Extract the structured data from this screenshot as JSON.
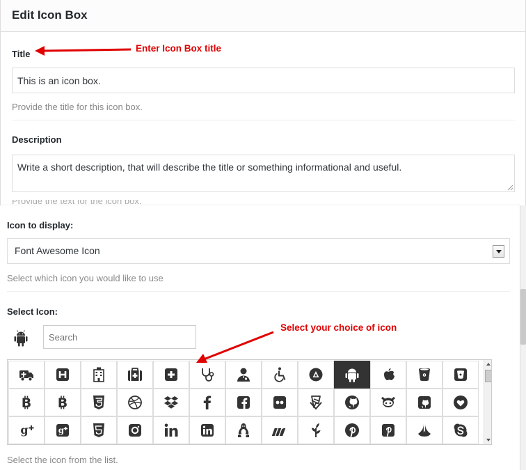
{
  "dialog": {
    "title": "Edit Icon Box"
  },
  "title_field": {
    "label": "Title",
    "value": "This is an icon box.",
    "help": "Provide the title for this icon box."
  },
  "description_field": {
    "label": "Description",
    "value": "Write a short description, that will describe the title or something informational and useful.",
    "help": "Provide the text for the icon box."
  },
  "icon_display": {
    "label": "Icon to display:",
    "selected": "Font Awesome Icon",
    "help": "Select which icon you would like to use"
  },
  "icon_select": {
    "label": "Select Icon:",
    "search_placeholder": "Search",
    "help": "Select the icon from the list.",
    "preview_icon": "android-icon",
    "selected_icon": "android-icon",
    "icons": [
      "ambulance-icon",
      "h-square-icon",
      "hospital-icon",
      "medkit-icon",
      "plus-square-icon",
      "stethoscope-icon",
      "user-md-icon",
      "wheelchair-icon",
      "adn-icon",
      "android-icon",
      "apple-icon",
      "bitbucket-icon",
      "bitbucket-square-icon",
      "bitcoin-icon",
      "btc-icon",
      "css3-icon",
      "dribbble-icon",
      "dropbox-icon",
      "facebook-icon",
      "facebook-square-icon",
      "flickr-icon",
      "foursquare-icon",
      "github-icon",
      "github-alt-icon",
      "github-square-icon",
      "gittip-icon",
      "google-plus-icon",
      "google-plus-square-icon",
      "html5-icon",
      "instagram-icon",
      "linkedin-icon",
      "linkedin-square-icon",
      "linux-icon",
      "maxcdn-icon",
      "pagelines-icon",
      "pinterest-icon",
      "pinterest-square-icon",
      "renren-icon",
      "skype-icon"
    ]
  },
  "annotations": {
    "title_note": "Enter Icon Box title",
    "icon_note": "Select your choice of icon"
  },
  "colors": {
    "annotation": "#e00000",
    "selected_cell": "#333333"
  }
}
